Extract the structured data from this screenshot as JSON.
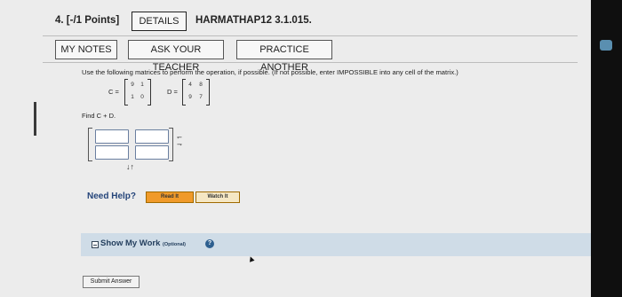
{
  "header": {
    "question_number": "4.  [-/1 Points]",
    "details_label": "DETAILS",
    "assignment_code": "HARMATHAP12 3.1.015."
  },
  "toolbar": {
    "my_notes_label": "MY NOTES",
    "ask_teacher_label": "ASK YOUR TEACHER",
    "practice_another_label": "PRACTICE ANOTHER"
  },
  "question": {
    "instructions": "Use the following matrices to perform the operation, if possible. (If not possible, enter IMPOSSIBLE into any cell of the matrix.)",
    "matrix_c": {
      "label": "C =",
      "rows": [
        [
          "9",
          "1"
        ],
        [
          "1",
          "0"
        ]
      ]
    },
    "matrix_d": {
      "label": "D =",
      "rows": [
        [
          "4",
          "8"
        ],
        [
          "9",
          "7"
        ]
      ]
    },
    "prompt": "Find C + D."
  },
  "help": {
    "title": "Need Help?",
    "read_it_label": "Read It",
    "watch_it_label": "Watch It"
  },
  "show_work": {
    "label": "Show My Work",
    "optional_label": "(Optional)",
    "info_glyph": "?"
  },
  "submit_label": "Submit Answer",
  "icons": {
    "arrows": "↓↑",
    "side_arrows": [
      "↽",
      "⇁"
    ],
    "cursor": "▲"
  }
}
